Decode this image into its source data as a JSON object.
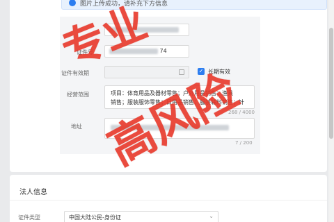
{
  "alert": {
    "text": "图片上传成功，请补充下方信息"
  },
  "form": {
    "name_value": "",
    "id_label": "证件号",
    "id_value_tail": "74",
    "validity_label": "证件有效期",
    "long_term_label": "长期有效",
    "scope_label": "经营范围",
    "scope_line1": "项目：体育用品及器材零售；户外用品销售；渔具",
    "scope_line2": "销售；服装服饰零售；日用品销售；服装辅料销售；针",
    "scope_counter": "268 / 4000",
    "address_label": "地址",
    "address_counter": "7 / 200"
  },
  "legal": {
    "section_title": "法人信息",
    "id_type_label": "证件类型",
    "id_type_value": "中国大陆公民-身份证"
  },
  "watermark": {
    "text1": "专业",
    "text2": "高风险"
  },
  "colors": {
    "accent": "#2d7ef0",
    "watermark": "#e8382a"
  }
}
